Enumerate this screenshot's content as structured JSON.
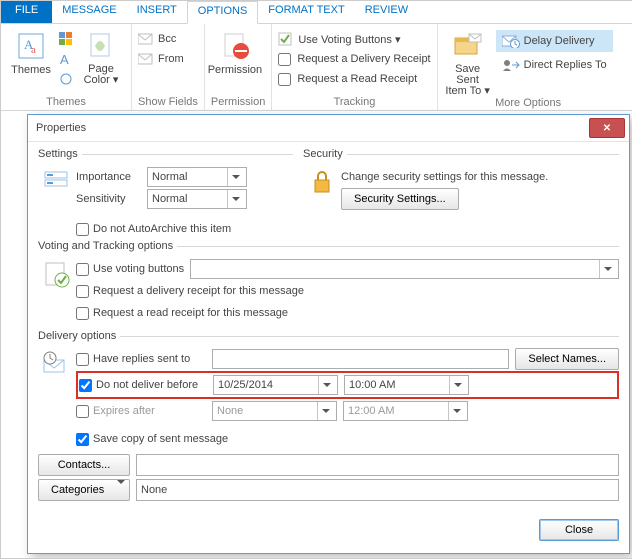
{
  "tabs": [
    "FILE",
    "MESSAGE",
    "INSERT",
    "OPTIONS",
    "FORMAT TEXT",
    "REVIEW"
  ],
  "ribbon": {
    "themes": {
      "label": "Themes",
      "page_color": "Page\nColor ▾",
      "group": "Themes"
    },
    "show": {
      "bcc": "Bcc",
      "from": "From",
      "group": "Show Fields"
    },
    "permission": {
      "label": "Permission",
      "group": "Permission"
    },
    "tracking": {
      "voting": "Use Voting Buttons ▾",
      "delivery": "Request a Delivery Receipt",
      "read": "Request a Read Receipt",
      "group": "Tracking"
    },
    "more": {
      "save_sent": "Save Sent\nItem To ▾",
      "delay": "Delay Delivery",
      "direct": "Direct Replies To",
      "group": "More Options"
    }
  },
  "dialog": {
    "title": "Properties",
    "settings": {
      "legend": "Settings",
      "importance_label": "Importance",
      "importance_value": "Normal",
      "sensitivity_label": "Sensitivity",
      "sensitivity_value": "Normal",
      "autoarchive": "Do not AutoArchive this item"
    },
    "security": {
      "legend": "Security",
      "text": "Change security settings for this message.",
      "button": "Security Settings..."
    },
    "voting": {
      "legend": "Voting and Tracking options",
      "use_voting": "Use voting buttons",
      "req_delivery": "Request a delivery receipt for this message",
      "req_read": "Request a read receipt for this message"
    },
    "delivery": {
      "legend": "Delivery options",
      "have_replies": "Have replies sent to",
      "select_names": "Select Names...",
      "not_before": "Do not deliver before",
      "not_before_date": "10/25/2014",
      "not_before_time": "10:00 AM",
      "expires": "Expires after",
      "expires_date": "None",
      "expires_time": "12:00 AM",
      "save_copy": "Save copy of sent message",
      "contacts": "Contacts...",
      "categories": "Categories",
      "categories_value": "None"
    },
    "close": "Close"
  }
}
